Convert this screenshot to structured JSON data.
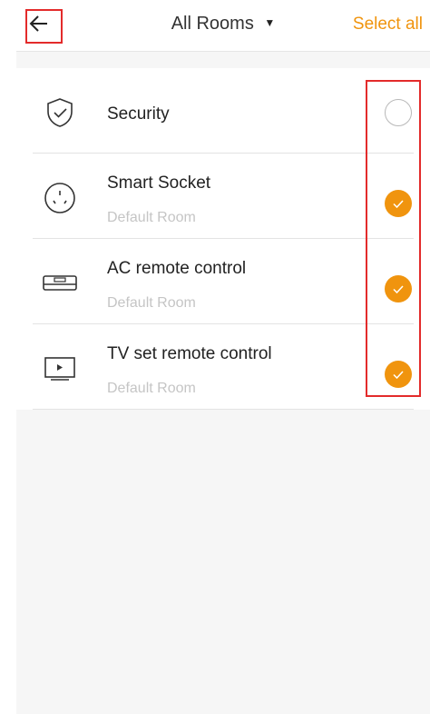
{
  "header": {
    "back_icon": "arrow-left-icon",
    "title": "All Rooms",
    "dropdown_icon": "caret-down-icon",
    "select_all_label": "Select all"
  },
  "devices": [
    {
      "name": "Security",
      "room": "",
      "icon": "shield-check-icon",
      "selected": false
    },
    {
      "name": "Smart Socket",
      "room": "Default Room",
      "icon": "socket-icon",
      "selected": true
    },
    {
      "name": "AC remote control",
      "room": "Default Room",
      "icon": "air-conditioner-icon",
      "selected": true
    },
    {
      "name": "TV set remote control",
      "room": "Default Room",
      "icon": "tv-icon",
      "selected": true
    }
  ],
  "colors": {
    "accent": "#f0940e",
    "highlight": "#e32b2b",
    "secondary_text": "#c5c5c5"
  }
}
